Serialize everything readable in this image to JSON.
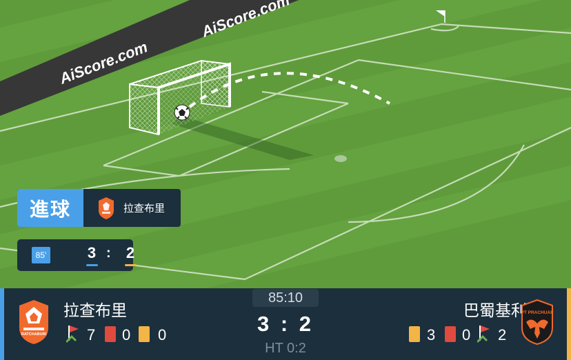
{
  "pitch": {
    "ad_text": "AiScore.com"
  },
  "goal_event": {
    "label": "進球",
    "team": "拉查布里"
  },
  "score_chip": {
    "minute": "85'",
    "home_score": "3",
    "separator": ":",
    "away_score": "2"
  },
  "match": {
    "clock": "85:10",
    "score": "3 : 2",
    "halftime": "HT 0:2"
  },
  "home": {
    "name": "拉查布里",
    "corners": "7",
    "red_cards": "0",
    "yellow_cards": "0",
    "crest_text": "RATCHABURI",
    "color": "#4aa0e8"
  },
  "away": {
    "name": "巴蜀基利",
    "yellow_cards": "3",
    "red_cards": "0",
    "corners": "2",
    "crest_text": "PT PRACHUAP",
    "color": "#f3b545"
  },
  "colors": {
    "panel": "#1c2f3d",
    "accent_blue": "#4aa0e8",
    "yellow_card": "#f3b545",
    "red_card": "#e04a3f"
  }
}
